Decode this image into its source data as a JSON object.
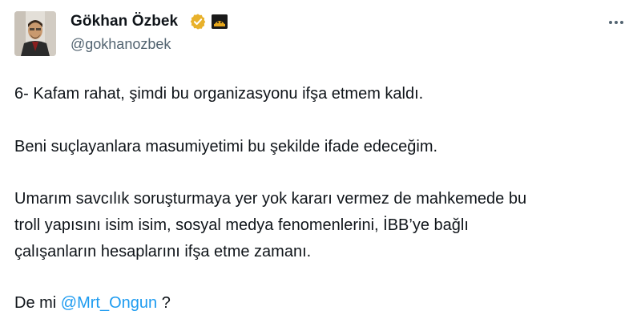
{
  "author": {
    "display_name": "Gökhan Özbek",
    "handle": "@gokhanozbek",
    "verified_color": "#e8b12b",
    "affiliation_icon": "affiliation-badge-icon"
  },
  "tweet": {
    "lines": [
      "6- Kafam rahat, şimdi bu organizasyonu ifşa etmem kaldı.",
      "Beni suçlayanlara masumiyetimi bu şekilde ifade edeceğim.",
      "Umarım savcılık soruşturmaya yer yok kararı vermez de mahkemede bu",
      "troll yapısını isim isim, sosyal medya fenomenlerini, İBB’ye bağlı",
      "çalışanların hesaplarını ifşa etme zamanı."
    ],
    "last_line_prefix": "De mi ",
    "mention": "@Mrt_Ongun",
    "last_line_suffix": " ?"
  },
  "colors": {
    "text": "#0f1419",
    "secondary": "#536471",
    "link": "#1d9bf0"
  },
  "icons": {
    "more": "more-options-icon",
    "verified": "verified-badge-icon"
  }
}
